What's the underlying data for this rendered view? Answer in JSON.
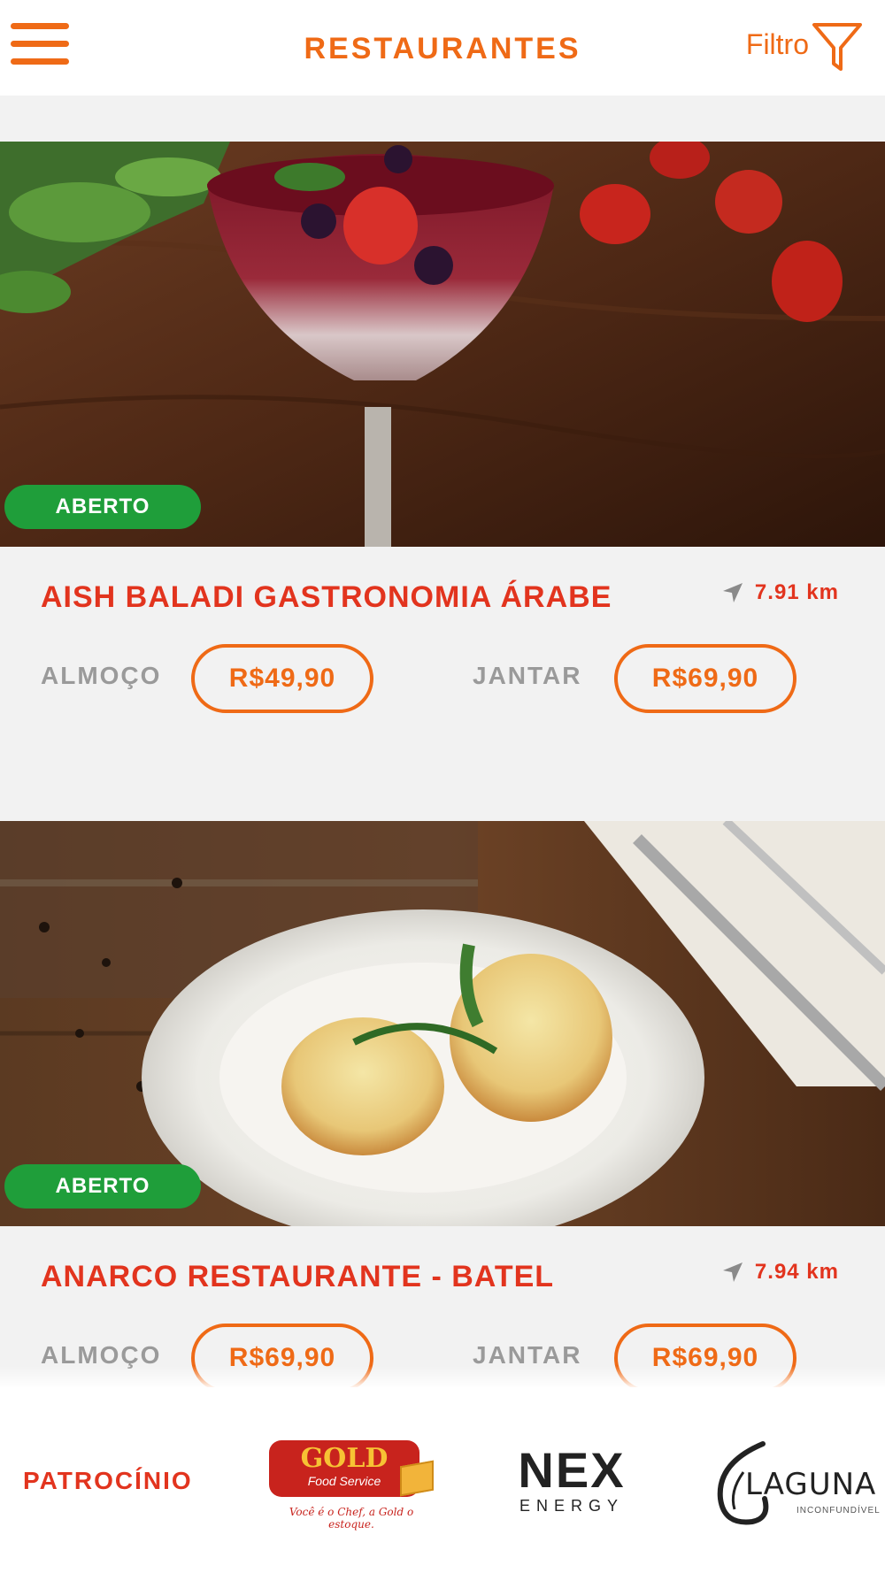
{
  "header": {
    "title": "RESTAURANTES",
    "filter_label": "Filtro"
  },
  "restaurants": [
    {
      "name": "AISH BALADI GASTRONOMIA ÁRABE",
      "status": "ABERTO",
      "distance": "7.91 km",
      "lunch_label": "ALMOÇO",
      "lunch_price": "R$49,90",
      "dinner_label": "JANTAR",
      "dinner_price": "R$69,90"
    },
    {
      "name": "ANARCO RESTAURANTE - BATEL",
      "status": "ABERTO",
      "distance": "7.94 km",
      "lunch_label": "ALMOÇO",
      "lunch_price": "R$69,90",
      "dinner_label": "JANTAR",
      "dinner_price": "R$69,90"
    }
  ],
  "footer": {
    "sponsor_label": "PATROCÍNIO",
    "sponsors": [
      {
        "name": "GOLD",
        "subtitle": "Food Service",
        "tagline": "Você é o Chef, a Gold o estoque."
      },
      {
        "name": "NEX",
        "subtitle": "ENERGY"
      },
      {
        "name": "LAGUNA",
        "subtitle": "INCONFUNDÍVEL"
      }
    ]
  },
  "colors": {
    "accent": "#ef6a16",
    "name_red": "#e2341e",
    "open_green": "#1f9e3a",
    "muted_label": "#9a9a9a"
  },
  "icons": [
    "menu-icon",
    "filter-icon",
    "navigation-arrow-icon"
  ]
}
